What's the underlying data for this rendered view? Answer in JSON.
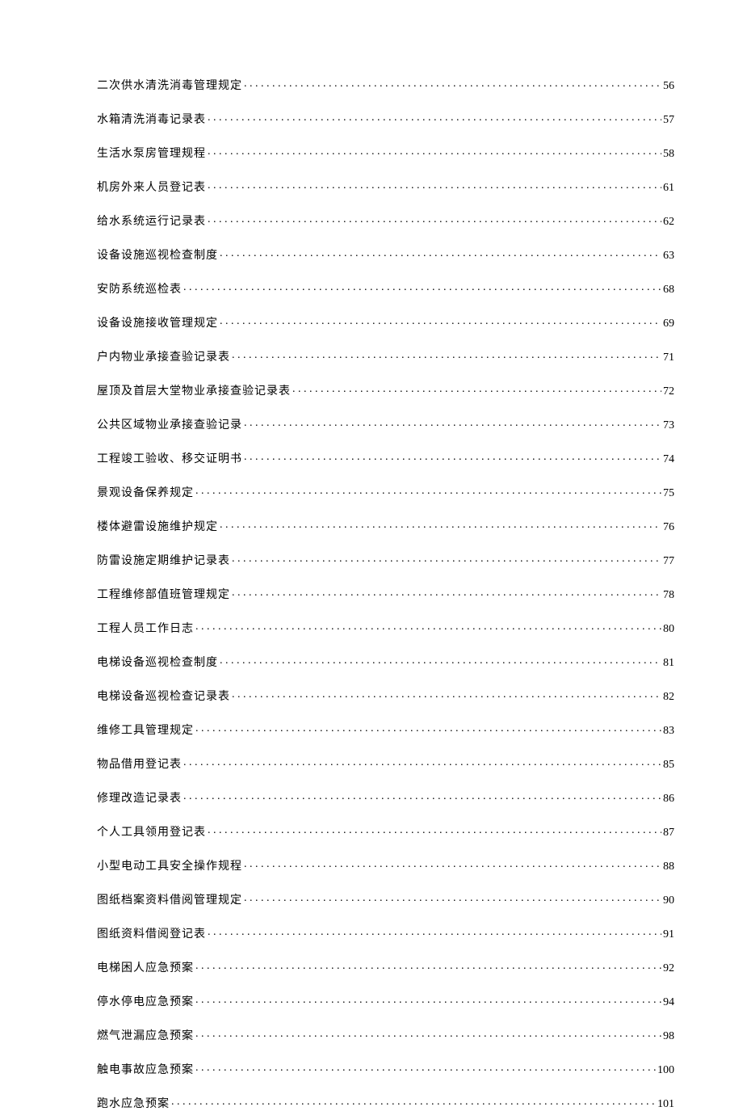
{
  "toc": {
    "entries": [
      {
        "title": "二次供水清洗消毒管理规定",
        "page": "56"
      },
      {
        "title": "水箱清洗消毒记录表",
        "page": "57"
      },
      {
        "title": "生活水泵房管理规程",
        "page": "58"
      },
      {
        "title": "机房外来人员登记表",
        "page": "61"
      },
      {
        "title": "给水系统运行记录表",
        "page": "62"
      },
      {
        "title": "设备设施巡视检查制度",
        "page": "63"
      },
      {
        "title": "安防系统巡检表",
        "page": "68"
      },
      {
        "title": "设备设施接收管理规定",
        "page": "69"
      },
      {
        "title": "户内物业承接查验记录表",
        "page": "71"
      },
      {
        "title": "屋顶及首层大堂物业承接查验记录表",
        "page": "72"
      },
      {
        "title": "公共区域物业承接查验记录",
        "page": "73"
      },
      {
        "title": "工程竣工验收、移交证明书",
        "page": "74"
      },
      {
        "title": "景观设备保养规定",
        "page": "75"
      },
      {
        "title": "楼体避雷设施维护规定",
        "page": "76"
      },
      {
        "title": "防雷设施定期维护记录表",
        "page": "77"
      },
      {
        "title": "工程维修部值班管理规定",
        "page": "78"
      },
      {
        "title": "工程人员工作日志",
        "page": "80"
      },
      {
        "title": "电梯设备巡视检查制度",
        "page": "81"
      },
      {
        "title": "电梯设备巡视检查记录表",
        "page": "82"
      },
      {
        "title": "维修工具管理规定",
        "page": "83"
      },
      {
        "title": "物品借用登记表",
        "page": "85"
      },
      {
        "title": "修理改造记录表",
        "page": "86"
      },
      {
        "title": "个人工具领用登记表",
        "page": "87"
      },
      {
        "title": "小型电动工具安全操作规程",
        "page": "88"
      },
      {
        "title": "图纸档案资料借阅管理规定",
        "page": "90"
      },
      {
        "title": "图纸资料借阅登记表",
        "page": "91"
      },
      {
        "title": "电梯困人应急预案",
        "page": "92"
      },
      {
        "title": "停水停电应急预案",
        "page": "94"
      },
      {
        "title": "燃气泄漏应急预案",
        "page": "98"
      },
      {
        "title": "触电事故应急预案",
        "page": "100"
      },
      {
        "title": "跑水应急预案",
        "page": "101"
      }
    ]
  }
}
